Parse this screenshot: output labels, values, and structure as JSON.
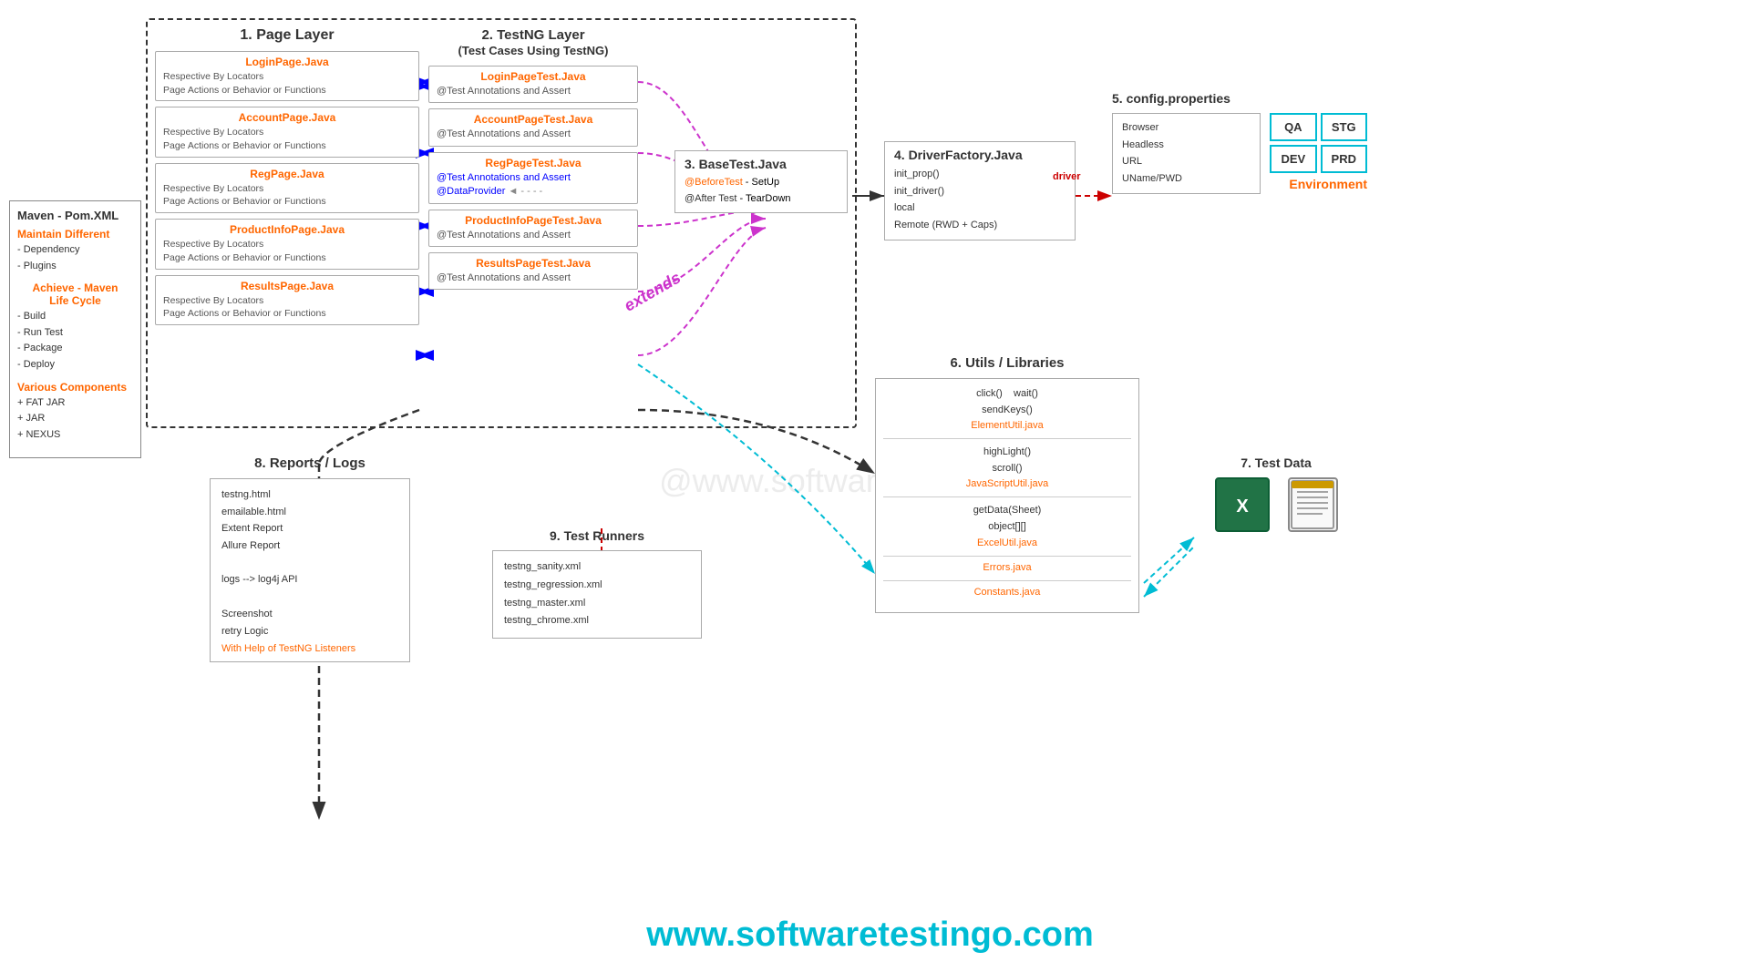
{
  "watermark": "@www.softwaretestingo.com",
  "bottom_url": "www.softwaretestingo.com",
  "page_layer": {
    "title": "1. Page Layer",
    "boxes": [
      {
        "title": "LoginPage.Java",
        "text": "Respective By Locators\nPage Actions or Behavior or Functions"
      },
      {
        "title": "AccountPage.Java",
        "text": "Respective By Locators\nPage Actions or Behavior or Functions"
      },
      {
        "title": "RegPage.Java",
        "text": "Respective By Locators\nPage Actions or Behavior or Functions"
      },
      {
        "title": "ProductInfoPage.Java",
        "text": "Respective By Locators\nPage Actions or Behavior or Functions"
      },
      {
        "title": "ResultsPage.Java",
        "text": "Respective By Locators\nPage Actions or Behavior or Functions"
      }
    ]
  },
  "testng_layer": {
    "title": "2. TestNG Layer\n(Test Cases Using TestNG)",
    "boxes": [
      {
        "title": "LoginPageTest.Java",
        "text": "@Test Annotations and Assert"
      },
      {
        "title": "AccountPageTest.Java",
        "text": "@Test Annotations and Assert"
      },
      {
        "title": "RegPageTest.Java",
        "text": "@Test Annotations and Assert\n@DataProvider"
      },
      {
        "title": "ProductInfoPageTest.Java",
        "text": "@Test Annotations and Assert"
      },
      {
        "title": "ResultsPageTest.Java",
        "text": "@Test Annotations and Assert"
      }
    ]
  },
  "basetest": {
    "title": "3. BaseTest.Java",
    "before_test": "@BeforeTest - SetUp",
    "after_test": "@After Test  - TearDown"
  },
  "driver_factory": {
    "title": "4. DriverFactory.Java",
    "lines": [
      "init_prop()",
      "init_driver()",
      "local",
      "Remote (RWD + Caps)"
    ],
    "driver_label": "driver"
  },
  "config_properties": {
    "title": "5. config.properties",
    "text_lines": [
      "Browser",
      "Headless",
      "URL",
      "UName/PWD"
    ],
    "env_items": [
      "QA",
      "STG",
      "DEV",
      "PRD"
    ],
    "env_label": "Environment"
  },
  "utils": {
    "title": "6. Utils / Libraries",
    "sections": [
      {
        "methods": "click()    wait()\nsendKeys()",
        "file": "ElementUtil.java"
      },
      {
        "methods": "highLight()\nscroll()",
        "file": "JavaScriptUtil.java"
      },
      {
        "methods": "getData(Sheet)\nobject[][]",
        "file": "ExcelUtil.java"
      },
      {
        "methods": "",
        "file": "Errors.java"
      },
      {
        "methods": "",
        "file": "Constants.java"
      }
    ]
  },
  "test_data": {
    "title": "7. Test Data",
    "icons": [
      "Excel",
      "Notepad"
    ]
  },
  "reports": {
    "title": "8. Reports / Logs",
    "lines": [
      "testng.html",
      "emailable.html",
      "Extent Report",
      "Allure Report",
      "",
      "logs --> log4j API",
      "",
      "Screenshot",
      "retry Logic"
    ],
    "footer": "With Help of TestNG Listeners"
  },
  "test_runners": {
    "title": "9. Test Runners",
    "lines": [
      "testng_sanity.xml",
      "testng_regression.xml",
      "testng_master.xml",
      "testng_chrome.xml"
    ]
  },
  "maven": {
    "title": "Maven - Pom.XML",
    "maintain_title": "Maintain Different",
    "maintain_list": [
      "- Dependency",
      "- Plugins"
    ],
    "achieve_title": "Achieve - Maven\nLife Cycle",
    "achieve_list": [
      "- Build",
      "- Run Test",
      "- Package",
      "- Deploy"
    ],
    "components_title": "Various Components",
    "components_list": [
      "+ FAT JAR",
      "+ JAR",
      "+ NEXUS"
    ]
  },
  "extends_label": "extends",
  "driver_arrow_label": "driver",
  "colors": {
    "orange": "#ff6600",
    "blue": "#0000ff",
    "dark_blue": "#00008b",
    "purple": "#cc33cc",
    "teal": "#00bcd4",
    "red": "#cc0000",
    "dashed_black": "#333"
  }
}
